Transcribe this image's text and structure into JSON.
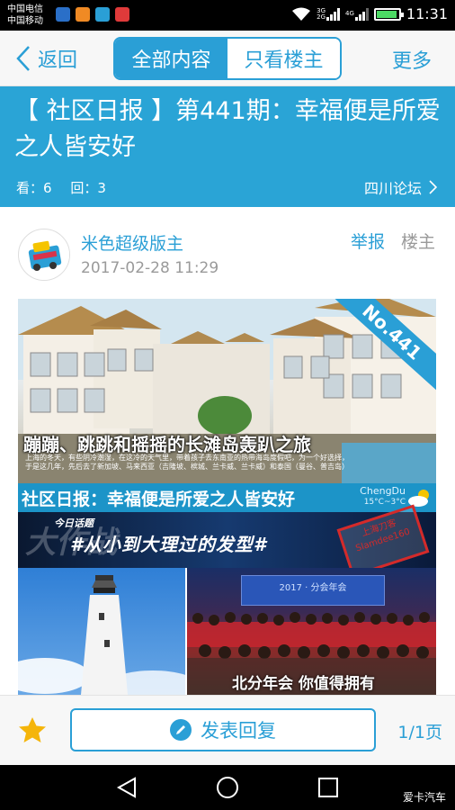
{
  "status_bar": {
    "carrier_1": "中国电信",
    "carrier_2": "中国移动",
    "net_label_1": "3G",
    "net_label_2": "2G",
    "net_label_3": "4G",
    "time": "11:31",
    "battery_level": 0.85
  },
  "nav": {
    "back_label": "返回",
    "tab_all": "全部内容",
    "tab_op_only": "只看楼主",
    "more_label": "更多"
  },
  "thread": {
    "title": "【 社区日报 】第441期：幸福便是所爱之人皆安好",
    "views_label": "看：6",
    "replies_label": "回：3",
    "forum_name": "四川论坛"
  },
  "post": {
    "author_name": "米色超级版主",
    "timestamp": "2017-02-28 11:29",
    "report_label": "举报",
    "floor_label": "楼主",
    "image": {
      "issue_ribbon": "No.441",
      "resort_caption": "蹦蹦、跳跳和摇摇的长滩岛轰趴之旅",
      "resort_small_text": "上海的冬天，有些阴冷潮湿，在这冷的天气里，带着孩子去东南亚的热带海岛度假吧，为一个好选择，于是这几年，先后去了新加坡、马来西亚（吉隆坡、槟城、兰卡威、兰卡威）和泰国（曼谷、普吉岛）",
      "daily_banner_text": "社区日报：幸福便是所爱之人皆安好",
      "daily_city": "ChengDu",
      "daily_temp": "15°C~3°C",
      "topic_tag": "今日话题",
      "topic_text": "#从小到大理过的发型#",
      "topic_watermark": "大作战",
      "stamp_text": "上海刀客 Slamdee160",
      "party_screen_text": "2017 · 分会年会",
      "party_caption": "北分年会 你值得拥有"
    }
  },
  "bottom_bar": {
    "reply_label": "发表回复",
    "page_label": "1/1页"
  },
  "watermark": "爱卡汽车",
  "colors": {
    "accent": "#2a9fd6",
    "banner": "#2aa4d6",
    "star": "#f5b50a"
  }
}
